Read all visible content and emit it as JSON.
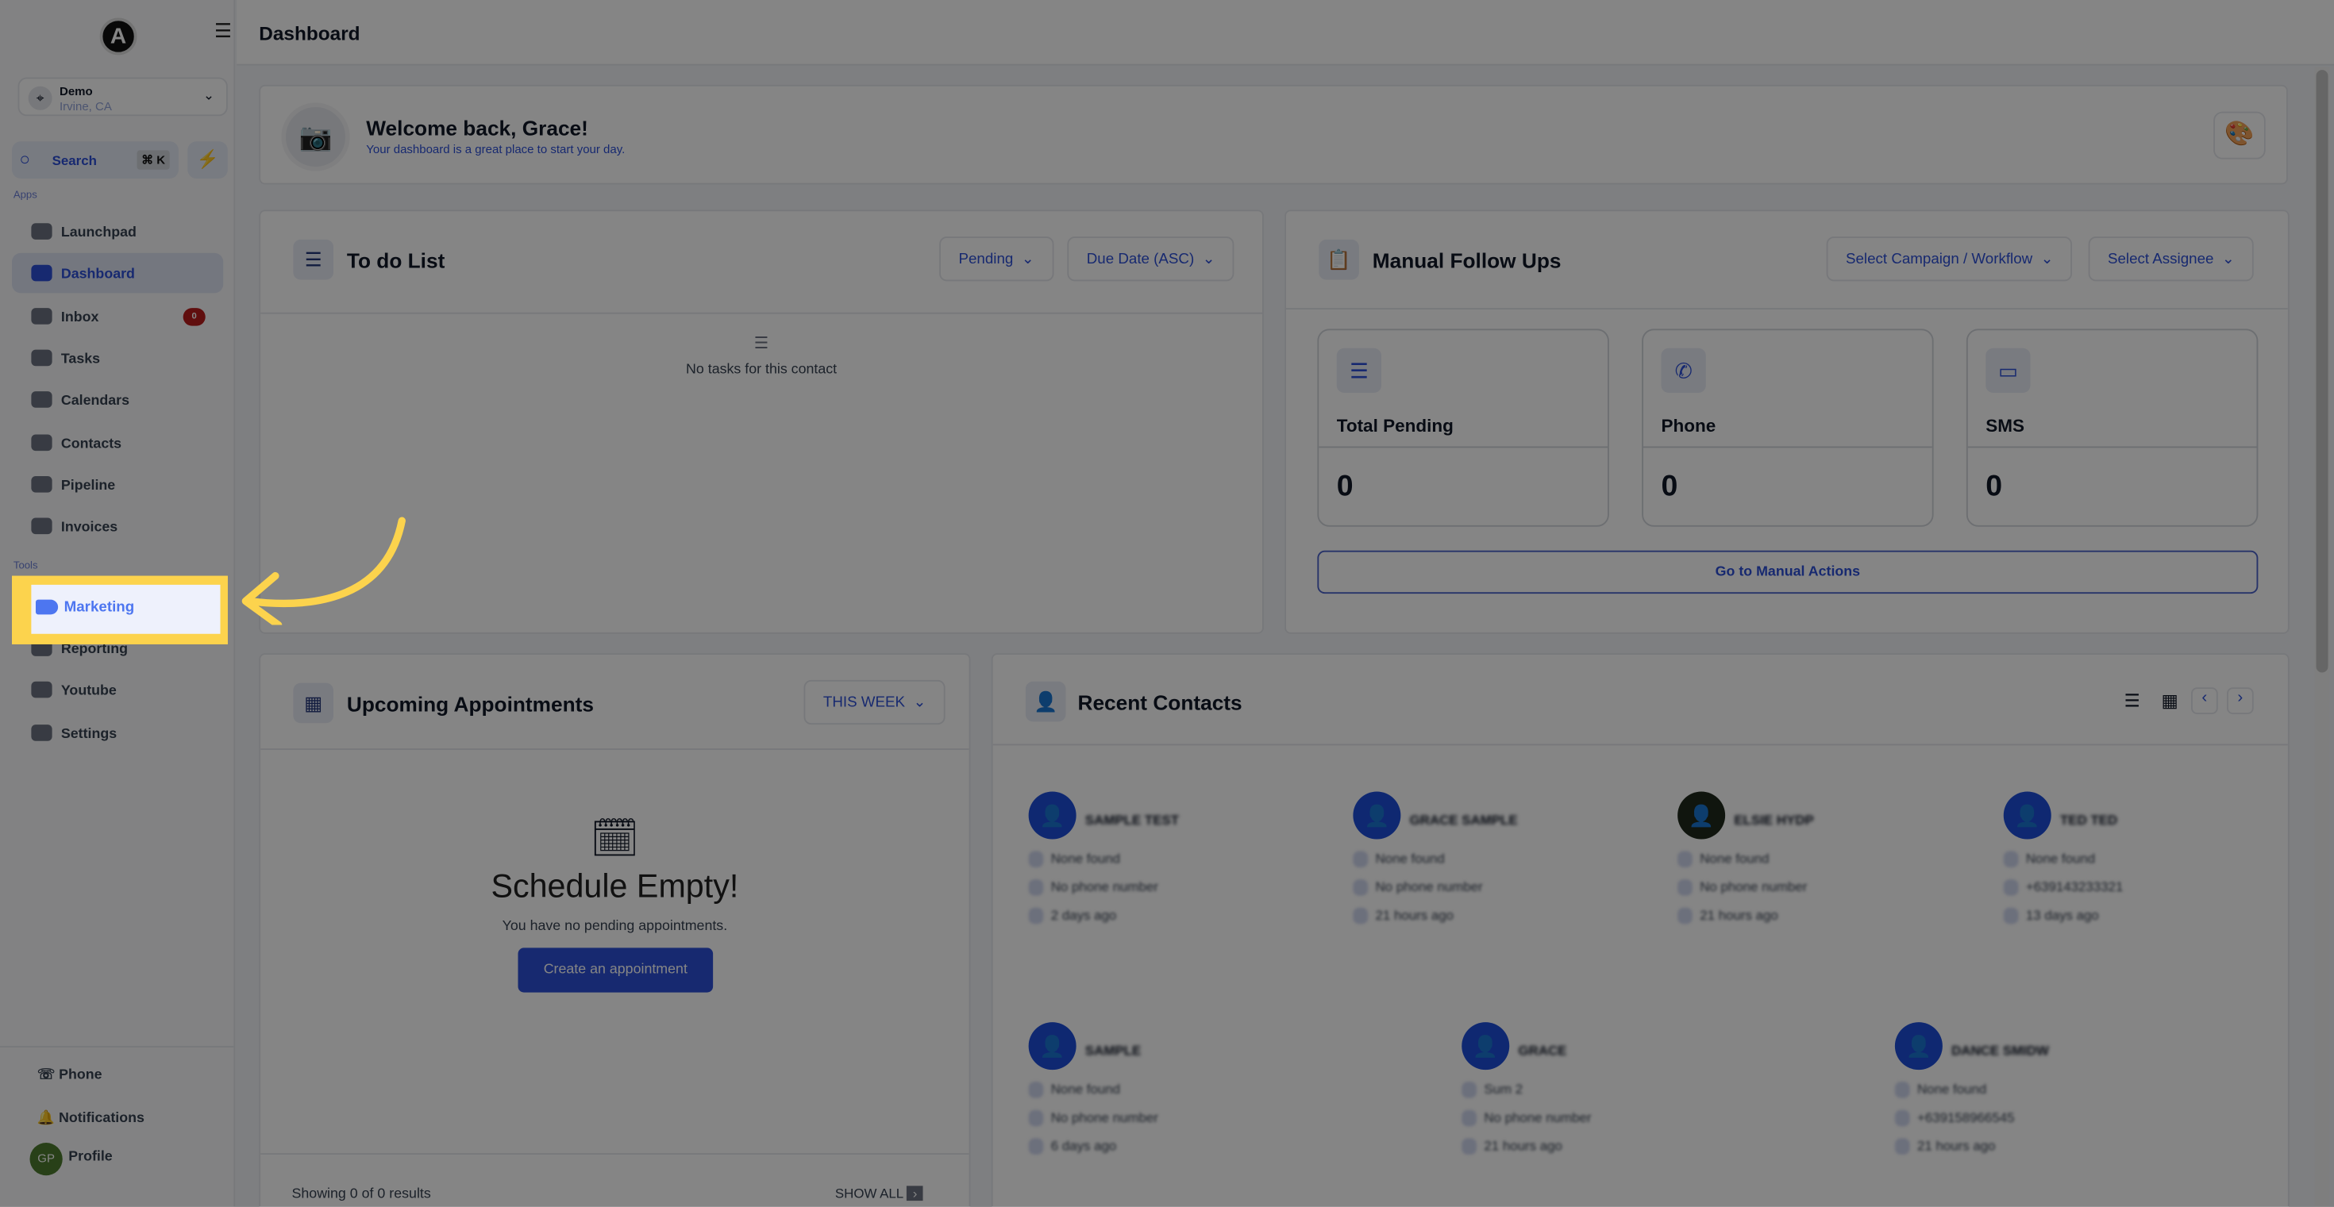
{
  "sidebar": {
    "logo_letter": "A",
    "location": {
      "name": "Demo",
      "city": "Irvine, CA"
    },
    "search": {
      "label": "Search",
      "shortcut": "⌘ K"
    },
    "apps_label": "Apps",
    "apps": [
      {
        "label": "Launchpad"
      },
      {
        "label": "Dashboard",
        "active": true
      },
      {
        "label": "Inbox",
        "badge": "0"
      },
      {
        "label": "Tasks"
      },
      {
        "label": "Calendars"
      },
      {
        "label": "Contacts"
      },
      {
        "label": "Pipeline"
      },
      {
        "label": "Invoices"
      }
    ],
    "tools_label": "Tools",
    "tools": [
      {
        "label": "Marketing",
        "highlighted": true
      },
      {
        "label": "Reporting"
      },
      {
        "label": "Youtube"
      },
      {
        "label": "Settings"
      }
    ],
    "footer": {
      "phone": "Phone",
      "notifications": "Notifications",
      "profile": "Profile",
      "avatar_initials": "GP"
    }
  },
  "header": {
    "title": "Dashboard"
  },
  "welcome": {
    "title": "Welcome back, Grace!",
    "subtitle": "Your dashboard is a great place to start your day."
  },
  "todo": {
    "title": "To do List",
    "filter": "Pending",
    "sort": "Due Date (ASC)",
    "empty": "No tasks for this contact"
  },
  "followups": {
    "title": "Manual Follow Ups",
    "campaign_select": "Select Campaign / Workflow",
    "assignee_select": "Select Assignee",
    "stats": [
      {
        "label": "Total Pending",
        "value": "0"
      },
      {
        "label": "Phone",
        "value": "0"
      },
      {
        "label": "SMS",
        "value": "0"
      }
    ],
    "action": "Go to Manual Actions"
  },
  "appointments": {
    "title": "Upcoming Appointments",
    "range": "THIS WEEK",
    "empty_title": "Schedule Empty!",
    "empty_text": "You have no pending appointments.",
    "create": "Create an appointment",
    "results": "Showing 0 of 0 results",
    "show_all": "SHOW ALL"
  },
  "contacts": {
    "title": "Recent Contacts",
    "items": [
      {
        "name": "SAMPLE TEST",
        "email": "None found",
        "phone": "No phone number",
        "time": "2 days ago"
      },
      {
        "name": "GRACE SAMPLE",
        "email": "None found",
        "phone": "No phone number",
        "time": "21 hours ago"
      },
      {
        "name": "ELSIE HYDP",
        "email": "None found",
        "phone": "No phone number",
        "time": "21 hours ago"
      },
      {
        "name": "TED TED",
        "email": "None found",
        "phone": "+639143233321",
        "time": "13 days ago"
      },
      {
        "name": "SAMPLE",
        "email": "None found",
        "phone": "No phone number",
        "time": "6 days ago"
      },
      {
        "name": "GRACE",
        "email": "Sum 2",
        "phone": "No phone number",
        "time": "21 hours ago"
      },
      {
        "name": "DANCE SMIDW",
        "email": "None found",
        "phone": "+639158966545",
        "time": "21 hours ago"
      }
    ]
  },
  "colors": {
    "accent": "#2c4fd6",
    "highlight": "#fcd34d",
    "badge": "#b91c1c"
  }
}
